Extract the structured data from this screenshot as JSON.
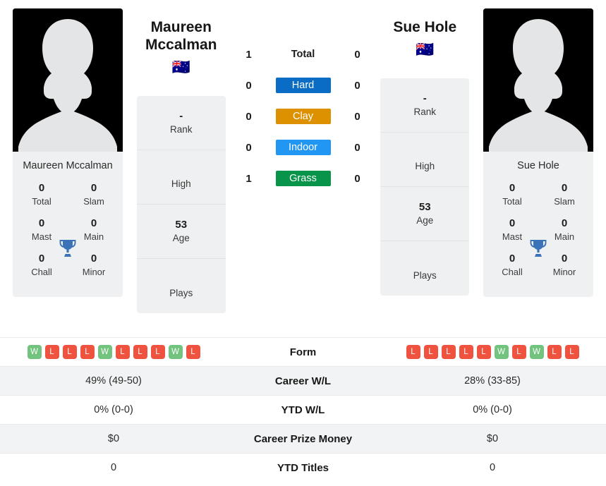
{
  "players": {
    "left": {
      "name": "Maureen Mccalman",
      "caption": "Maureen Mccalman",
      "flag": "🇦🇺",
      "avatar_icon": "person-placeholder-icon",
      "titles": {
        "total_value": "0",
        "total_label": "Total",
        "slam_value": "0",
        "slam_label": "Slam",
        "mast_value": "0",
        "mast_label": "Mast",
        "main_value": "0",
        "main_label": "Main",
        "chall_value": "0",
        "chall_label": "Chall",
        "minor_value": "0",
        "minor_label": "Minor",
        "trophy_icon": "trophy-icon"
      },
      "info": [
        {
          "value": "-",
          "label": "Rank"
        },
        {
          "value": "",
          "label": "High"
        },
        {
          "value": "53",
          "label": "Age"
        },
        {
          "value": "",
          "label": "Plays"
        }
      ],
      "form": [
        "W",
        "L",
        "L",
        "L",
        "W",
        "L",
        "L",
        "L",
        "W",
        "L"
      ],
      "career_wl": "49% (49-50)",
      "ytd_wl": "0% (0-0)",
      "career_prize_money": "$0",
      "ytd_titles": "0"
    },
    "right": {
      "name": "Sue Hole",
      "caption": "Sue Hole",
      "flag": "🇦🇺",
      "avatar_icon": "person-placeholder-icon",
      "titles": {
        "total_value": "0",
        "total_label": "Total",
        "slam_value": "0",
        "slam_label": "Slam",
        "mast_value": "0",
        "mast_label": "Mast",
        "main_value": "0",
        "main_label": "Main",
        "chall_value": "0",
        "chall_label": "Chall",
        "minor_value": "0",
        "minor_label": "Minor",
        "trophy_icon": "trophy-icon"
      },
      "info": [
        {
          "value": "-",
          "label": "Rank"
        },
        {
          "value": "",
          "label": "High"
        },
        {
          "value": "53",
          "label": "Age"
        },
        {
          "value": "",
          "label": "Plays"
        }
      ],
      "form": [
        "L",
        "L",
        "L",
        "L",
        "L",
        "W",
        "L",
        "W",
        "L",
        "L"
      ],
      "career_wl": "28% (33-85)",
      "ytd_wl": "0% (0-0)",
      "career_prize_money": "$0",
      "ytd_titles": "0"
    }
  },
  "surfaces": [
    {
      "label": "Total",
      "left": "1",
      "right": "0",
      "color": "transparent",
      "plain": true
    },
    {
      "label": "Hard",
      "left": "0",
      "right": "0",
      "color": "#0a6cc4",
      "plain": false
    },
    {
      "label": "Clay",
      "left": "0",
      "right": "0",
      "color": "#dd9000",
      "plain": false
    },
    {
      "label": "Indoor",
      "left": "0",
      "right": "0",
      "color": "#2196f3",
      "plain": false
    },
    {
      "label": "Grass",
      "left": "1",
      "right": "0",
      "color": "#089449",
      "plain": false
    }
  ],
  "table": {
    "form_label": "Form",
    "career_wl_label": "Career W/L",
    "ytd_wl_label": "YTD W/L",
    "career_prize_money_label": "Career Prize Money",
    "ytd_titles_label": "YTD Titles"
  },
  "colors": {
    "win": "#71c37d",
    "loss": "#ef5340",
    "hard": "#0a6cc4",
    "clay": "#dd9000",
    "indoor": "#2196f3",
    "grass": "#089449",
    "trophy": "#3b72b8",
    "card_bg": "#eff0f1",
    "row_shade": "#f2f3f4"
  }
}
